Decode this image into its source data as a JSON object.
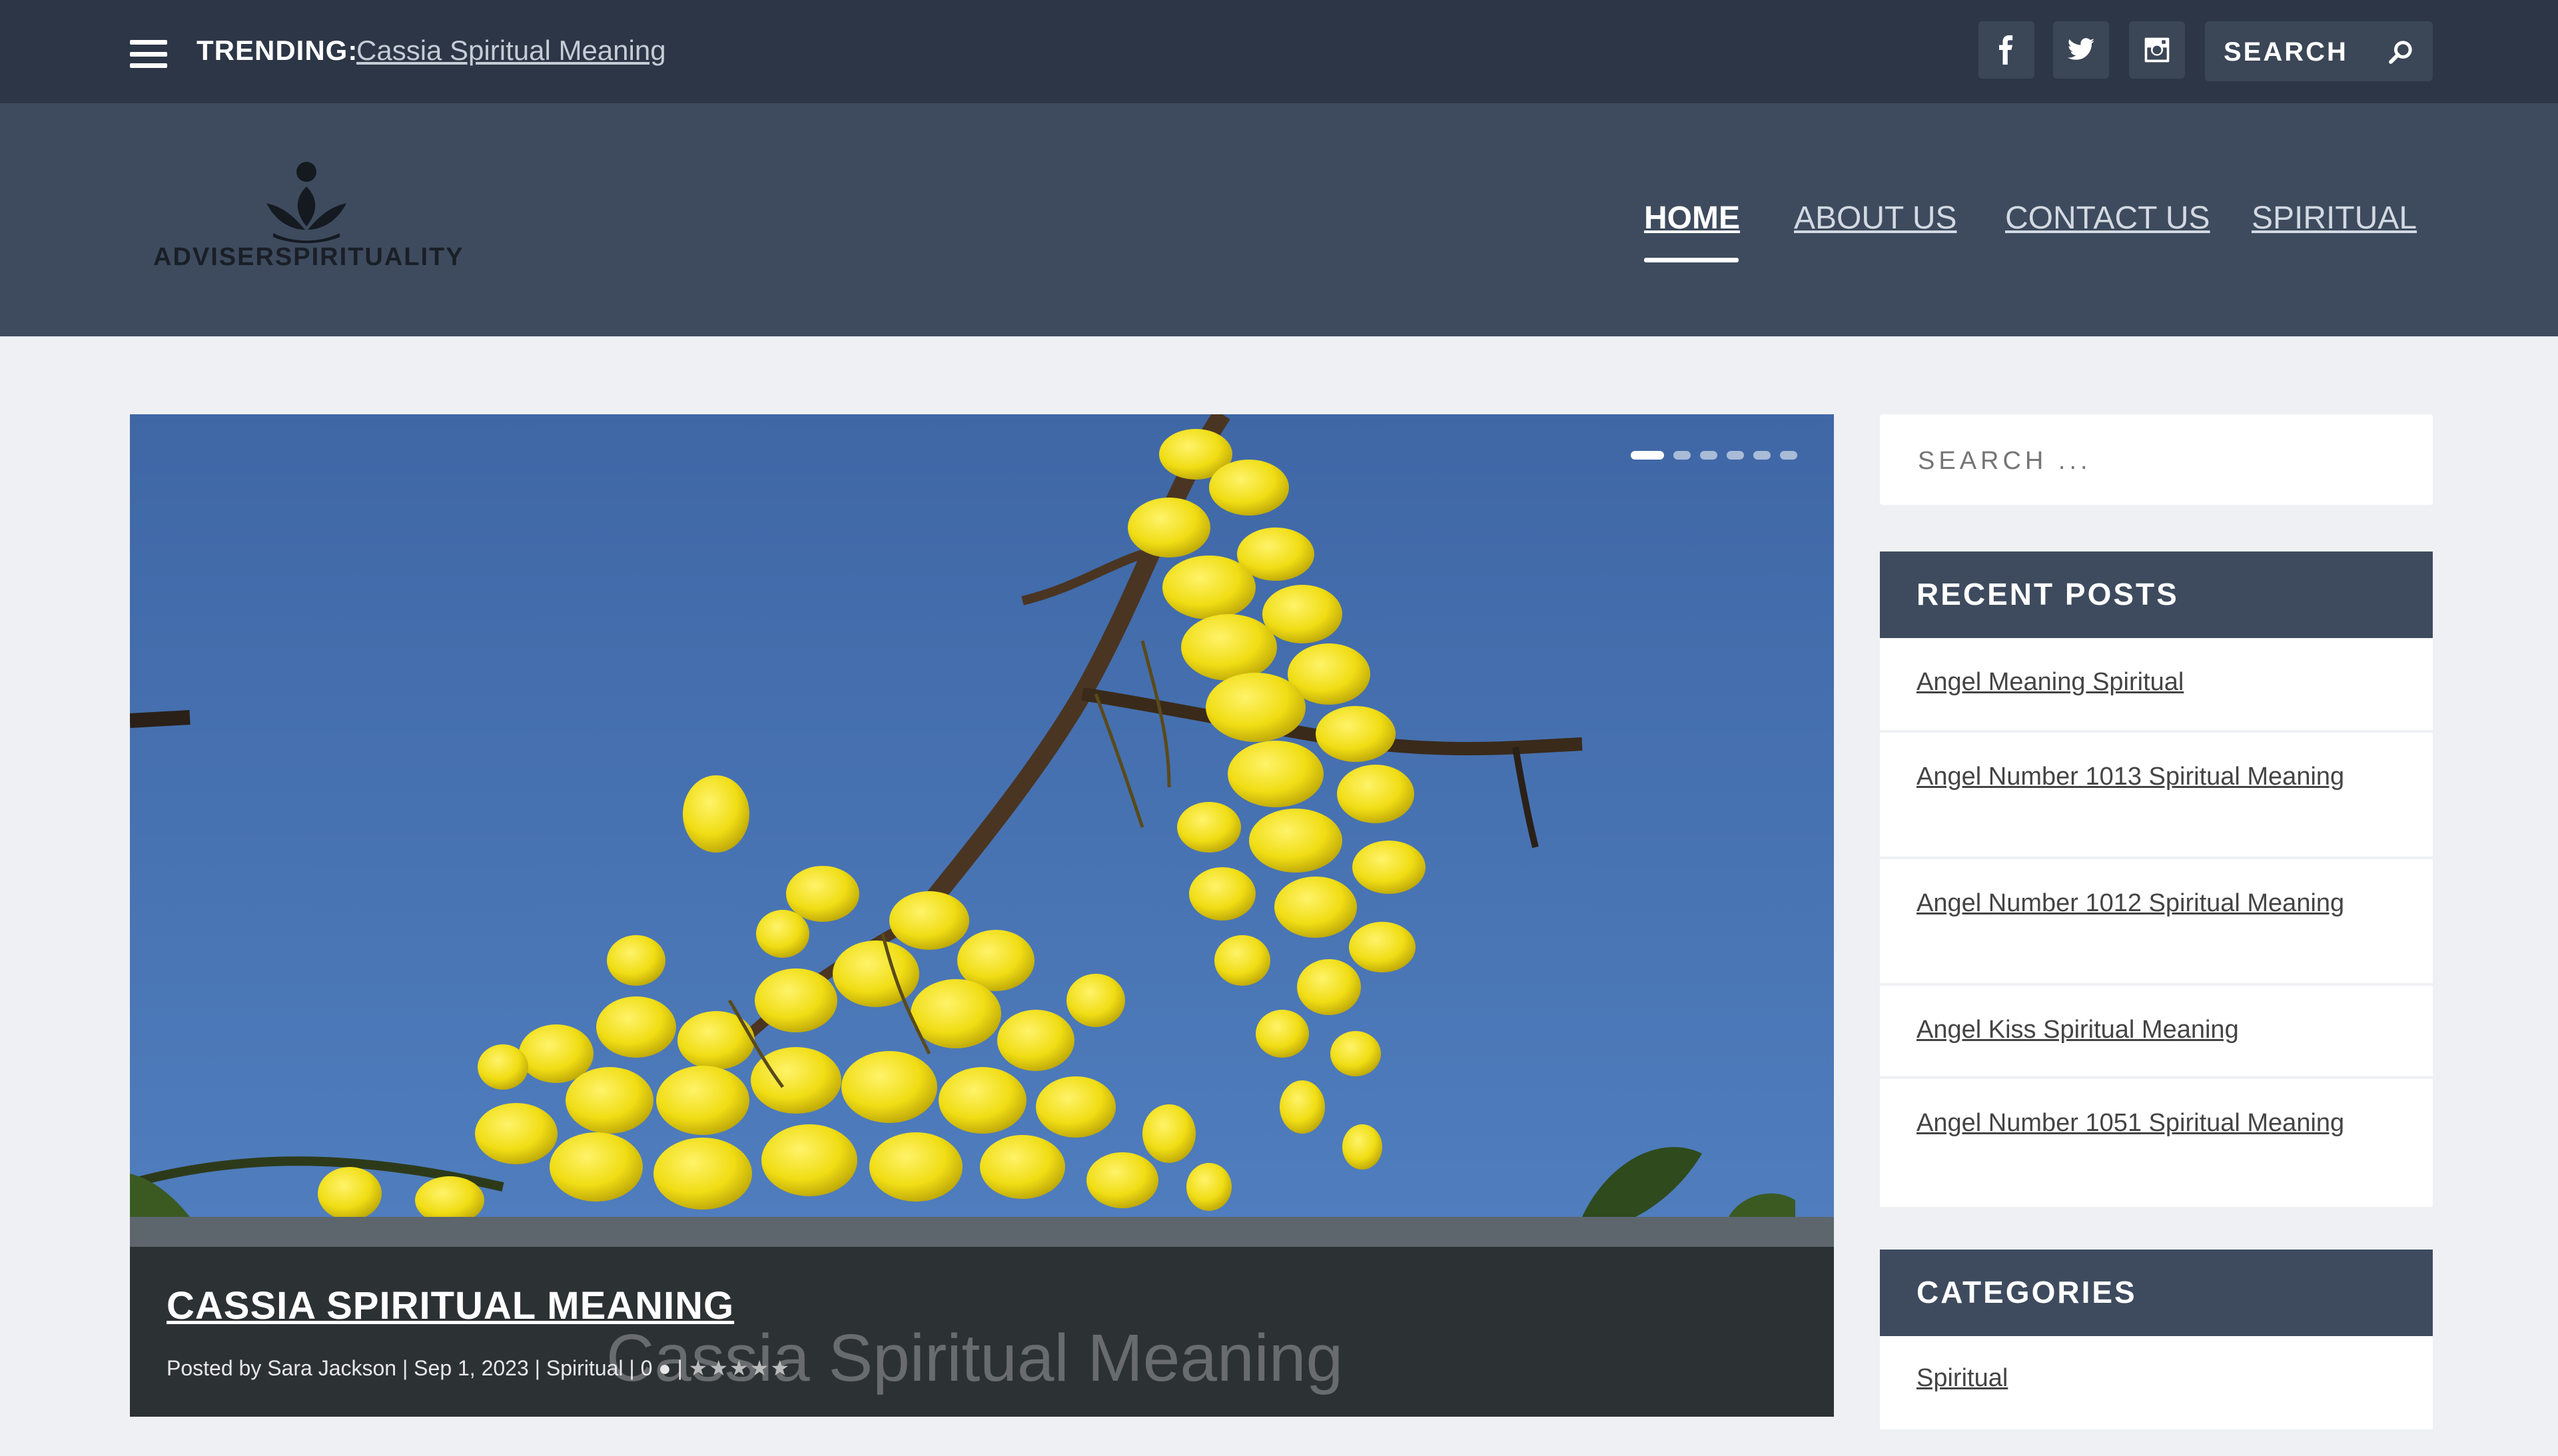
{
  "topbar": {
    "trending_label": "TRENDING:",
    "trending_link": "Cassia Spiritual Meaning",
    "search_label": "SEARCH",
    "social": [
      "facebook-icon",
      "twitter-icon",
      "instagram-icon"
    ]
  },
  "header": {
    "logo_text": "ADVISERSPIRITUALITY",
    "nav": [
      "HOME",
      "ABOUT US",
      "CONTACT US",
      "SPIRITUAL"
    ],
    "active_nav": "HOME"
  },
  "slider": {
    "title": "CASSIA SPIRITUAL MEANING",
    "meta": "Posted by Sara Jackson | Sep 1, 2023 | Spiritual | 0 ● |",
    "stars": "★★★★★",
    "ghost_title": "Cassia Spiritual Meaning",
    "slide_count": 6,
    "active_slide": 1
  },
  "sidebar": {
    "search_placeholder": "SEARCH ...",
    "recent_posts_title": "RECENT POSTS",
    "recent_posts": [
      "Angel Meaning Spiritual",
      "Angel Number 1013 Spiritual Meaning",
      "Angel Number 1012 Spiritual Meaning",
      "Angel Kiss Spiritual Meaning",
      "Angel Number 1051 Spiritual Meaning"
    ],
    "categories_title": "CATEGORIES",
    "categories": [
      "Spiritual"
    ]
  },
  "colors": {
    "topbar": "#2c3646",
    "header": "#3e4b5e",
    "page_bg": "#eef0f4",
    "sky": "#4a73ad",
    "flower": "#f2e21a"
  }
}
